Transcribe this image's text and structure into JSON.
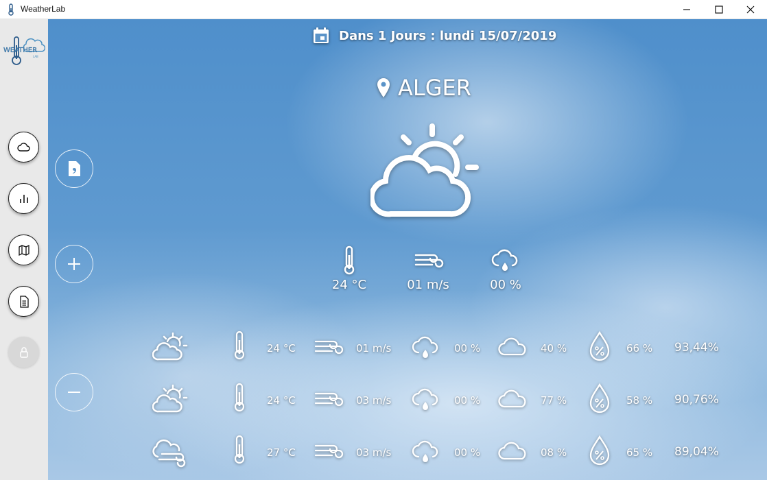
{
  "window": {
    "title": "WeatherLab"
  },
  "header": {
    "date_text": "Dans 1 Jours : lundi 15/07/2019",
    "city": "ALGER"
  },
  "current": {
    "temperature": "24 °C",
    "wind": "01 m/s",
    "precipitation": "00 %"
  },
  "forecast_rows": [
    {
      "icon": "partly-sunny-icon",
      "temperature": "24 °C",
      "wind": "01 m/s",
      "precipitation": "00 %",
      "cloud_cover": "40 %",
      "humidity": "66 %",
      "confidence": "93,44%"
    },
    {
      "icon": "partly-sunny-icon",
      "temperature": "24 °C",
      "wind": "03 m/s",
      "precipitation": "00 %",
      "cloud_cover": "77 %",
      "humidity": "58 %",
      "confidence": "90,76%"
    },
    {
      "icon": "cloudy-windy-icon",
      "temperature": "27 °C",
      "wind": "03 m/s",
      "precipitation": "00 %",
      "cloud_cover": "08 %",
      "humidity": "65 %",
      "confidence": "89,04%"
    }
  ],
  "colors": {
    "sidebar_bg": "#e9e9e9",
    "sky_top": "#4f8fcb",
    "sky_bottom": "#a9c8e6",
    "icon_white": "#ffffff"
  }
}
